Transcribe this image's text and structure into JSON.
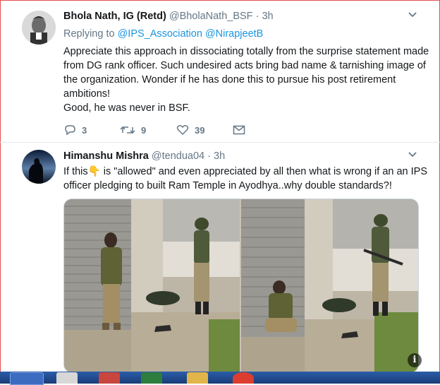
{
  "tweet1": {
    "name": "Bhola Nath, IG (Retd)",
    "handle": "@BholaNath_BSF",
    "sep": "·",
    "time": "3h",
    "replying_to": "Replying to",
    "reply_handles": [
      "@IPS_Association",
      "@NirapjeetB"
    ],
    "text_lines": [
      "Appreciate this approach in dissociating totally from the surprise statement made",
      "from DG rank officer. Such undesired acts bring bad name & tarnishing image of",
      "the organization. Wonder if he has done this to pursue his post retirement",
      "ambitions!",
      "Good, he was never in BSF."
    ],
    "reply_count": "3",
    "retweet_count": "9",
    "like_count": "39"
  },
  "tweet2": {
    "name": "Himanshu Mishra",
    "handle": "@tendua04",
    "sep": "·",
    "time": "3h",
    "text_part1": "If this",
    "emoji": "👇",
    "text_part2": " is \"allowed\" and even appreciated by all then what is wrong if an an IPS",
    "text_line2": "officer pledging to built Ram Temple in Ayodhya..why double standards?!",
    "info_label": "i"
  },
  "icons": {
    "caret": "chevron-down-icon",
    "reply": "reply-icon",
    "retweet": "retweet-icon",
    "like": "heart-icon",
    "dm": "envelope-icon"
  },
  "colors": {
    "link": "#1b95e0",
    "muted": "#657786",
    "text": "#14171a",
    "divider": "#e6ecf0"
  }
}
